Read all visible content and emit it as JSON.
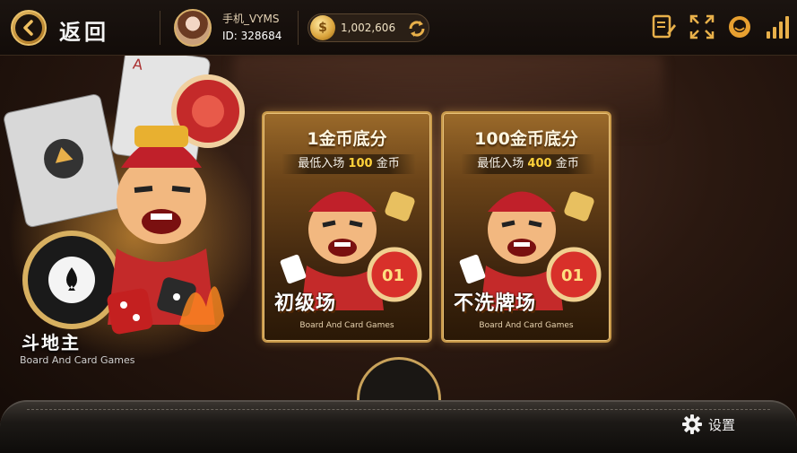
{
  "header": {
    "back_label": "返回",
    "username": "手机_VYMS",
    "user_id": "ID: 328684",
    "coins": "1,002,606"
  },
  "game": {
    "title": "斗地主",
    "subtitle": "Board And Card Games"
  },
  "rooms": [
    {
      "title": "1金币底分",
      "min_prefix": "最低入场",
      "min_amount": "100",
      "min_suffix": "金币",
      "name": "初级场",
      "caption": "Board And Card Games"
    },
    {
      "title": "100金币底分",
      "min_prefix": "最低入场",
      "min_amount": "400",
      "min_suffix": "金币",
      "name": "不洗牌场",
      "caption": "Board And Card Games"
    }
  ],
  "footer": {
    "settings_label": "设置"
  },
  "icons": {
    "back": "back-arrow-icon",
    "coin": "coin-icon",
    "refresh": "refresh-icon",
    "notes": "notes-icon",
    "fullscreen": "fullscreen-icon",
    "service": "customer-service-icon",
    "signal": "signal-icon",
    "settings": "gear-icon"
  },
  "colors": {
    "gold": "#c99a4a",
    "highlight": "#ffd23a"
  }
}
